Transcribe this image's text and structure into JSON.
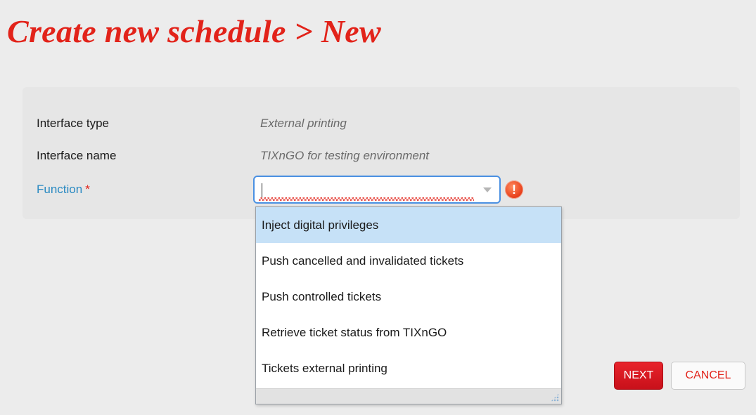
{
  "page": {
    "title": "Create new schedule > New"
  },
  "form": {
    "interface_type": {
      "label": "Interface type",
      "value": "External printing"
    },
    "interface_name": {
      "label": "Interface name",
      "value": "TIXnGO for testing environment"
    },
    "function": {
      "label": "Function",
      "required_marker": "*",
      "value": "",
      "has_error": true
    }
  },
  "dropdown": {
    "options": [
      "Inject digital privileges",
      "Push cancelled and invalidated tickets",
      "Push controlled tickets",
      "Retrieve ticket status from TIXnGO",
      "Tickets external printing"
    ],
    "highlighted_index": 0
  },
  "icons": {
    "error": "exclamation-circle-icon",
    "dropdown_trigger": "chevron-down-icon",
    "resize": "resize-grip-icon"
  },
  "actions": {
    "next_label": "NEXT",
    "cancel_label": "CANCEL"
  },
  "colors": {
    "brand_red": "#e2231a",
    "label_blue": "#2a8ac2",
    "focus_blue": "#4a90e2",
    "highlight": "#c6e1f7"
  }
}
